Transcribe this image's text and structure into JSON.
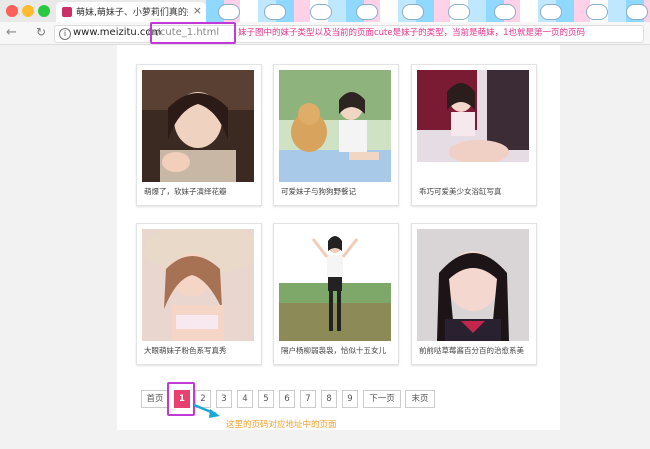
{
  "tab": {
    "title": "萌妹,萌妹子、小萝莉们真的好..."
  },
  "url": {
    "domain": "www.meizitu.com",
    "path": "/a/cute_1.html"
  },
  "annotations": {
    "url_note": "妹子图中的妹子类型以及当前的页面cute是妹子的类型，当前是萌妹，1也就是第一页的页码",
    "pager_note": "这里的页码对应地址中的页面"
  },
  "cards": [
    {
      "caption": "萌爆了，软妹子演绎花瓣"
    },
    {
      "caption": "可爱妹子与狗狗野餐记"
    },
    {
      "caption": "乖巧可爱美少女浴缸写真"
    },
    {
      "caption": "大眼萌妹子粉色系写真秀"
    },
    {
      "caption": "隔户杨柳弱袅袅，恰似十五女儿"
    },
    {
      "caption": "前前哒草莓酱百分百的治愈系美"
    }
  ],
  "pagination": {
    "first": "首页",
    "pages": [
      "1",
      "2",
      "3",
      "4",
      "5",
      "6",
      "7",
      "8",
      "9"
    ],
    "next": "下一页",
    "last": "末页",
    "current": "1"
  },
  "colors": {
    "accent_pink": "#e9416f",
    "highlight_purple": "#c23ad6",
    "note_pink": "#e5358c",
    "note_orange": "#f0a12a",
    "arrow_teal": "#1aa9d4"
  }
}
